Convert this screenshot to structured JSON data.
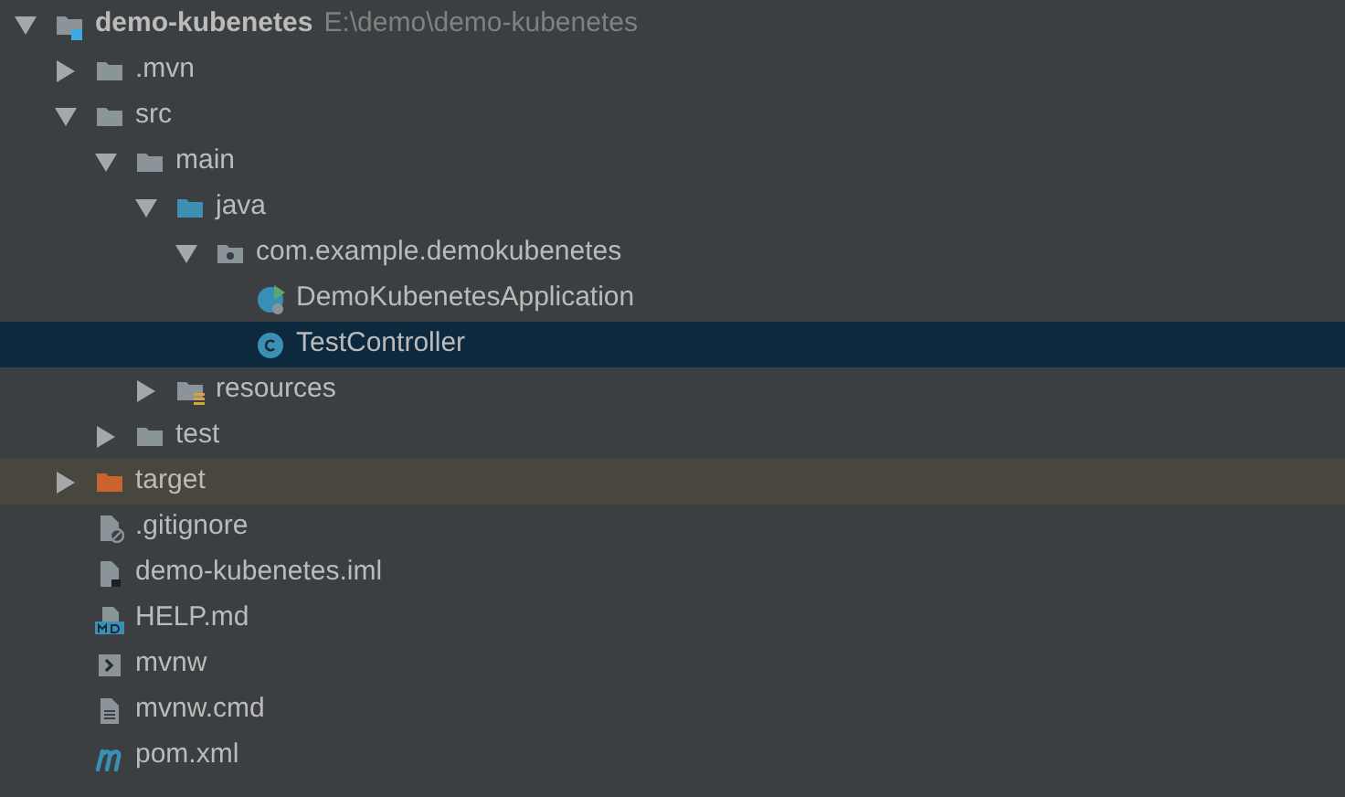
{
  "project_tree": [
    {
      "name": "demo-kubenetes",
      "path": "E:\\demo\\demo-kubenetes",
      "kind": "module",
      "expanded": true,
      "selected": false,
      "children": [
        {
          "name": ".mvn",
          "kind": "folder",
          "expanded": false,
          "selected": false
        },
        {
          "name": "src",
          "kind": "folder",
          "expanded": true,
          "selected": false,
          "children": [
            {
              "name": "main",
              "kind": "folder",
              "expanded": true,
              "selected": false,
              "children": [
                {
                  "name": "java",
                  "kind": "source-folder",
                  "expanded": true,
                  "selected": false,
                  "children": [
                    {
                      "name": "com.example.demokubenetes",
                      "kind": "package",
                      "expanded": true,
                      "selected": false,
                      "children": [
                        {
                          "name": "DemoKubenetesApplication",
                          "kind": "spring-class",
                          "selected": false
                        },
                        {
                          "name": "TestController",
                          "kind": "class",
                          "selected": true
                        }
                      ]
                    }
                  ]
                },
                {
                  "name": "resources",
                  "kind": "resources-folder",
                  "expanded": false,
                  "selected": false
                }
              ]
            },
            {
              "name": "test",
              "kind": "folder",
              "expanded": false,
              "selected": false
            }
          ]
        },
        {
          "name": "target",
          "kind": "excluded-folder",
          "expanded": false,
          "selected": false
        },
        {
          "name": ".gitignore",
          "kind": "ignore-file",
          "selected": false
        },
        {
          "name": "demo-kubenetes.iml",
          "kind": "iml-file",
          "selected": false
        },
        {
          "name": "HELP.md",
          "kind": "markdown-file",
          "selected": false
        },
        {
          "name": "mvnw",
          "kind": "shell-file",
          "selected": false
        },
        {
          "name": "mvnw.cmd",
          "kind": "text-file",
          "selected": false
        },
        {
          "name": "pom.xml",
          "kind": "maven-file",
          "selected": false
        }
      ]
    }
  ]
}
